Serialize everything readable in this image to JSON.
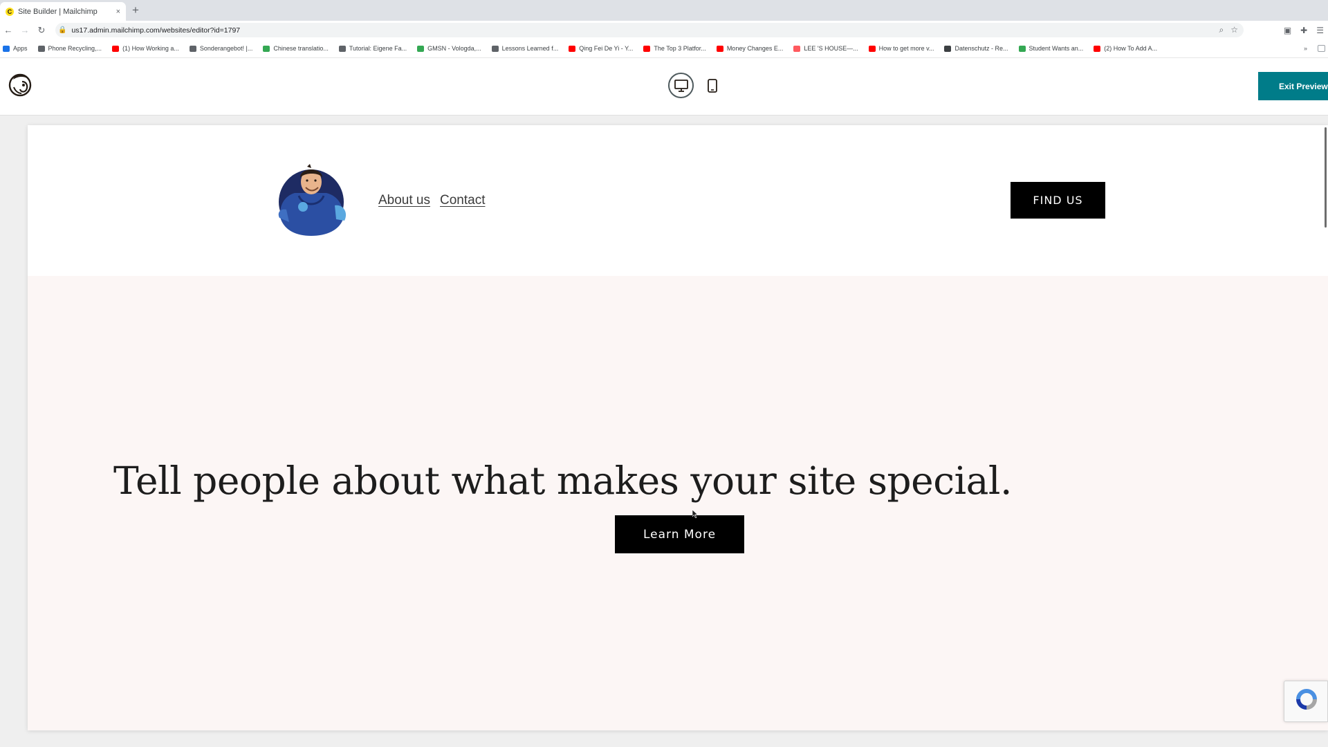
{
  "browser": {
    "tab_title": "Site Builder | Mailchimp",
    "tab_close": "×",
    "new_tab": "+",
    "url": "us17.admin.mailchimp.com/websites/editor?id=1797",
    "bookmarks": [
      {
        "label": "Apps",
        "icon": "apps-grid-icon",
        "color": "#1a73e8"
      },
      {
        "label": "Phone Recycling,...",
        "icon": "search-icon",
        "color": "#5f6368"
      },
      {
        "label": "(1) How Working a...",
        "icon": "youtube-icon",
        "color": "#ff0000"
      },
      {
        "label": "Sonderangebot! |...",
        "icon": "globe-icon",
        "color": "#5f6368"
      },
      {
        "label": "Chinese translatio...",
        "icon": "globe-icon",
        "color": "#34a853"
      },
      {
        "label": "Tutorial: Eigene Fa...",
        "icon": "hash-icon",
        "color": "#5f6368"
      },
      {
        "label": "GMSN - Vologda,...",
        "icon": "globe-icon",
        "color": "#34a853"
      },
      {
        "label": "Lessons Learned f...",
        "icon": "link-icon",
        "color": "#5f6368"
      },
      {
        "label": "Qing Fei De Yi - Y...",
        "icon": "youtube-icon",
        "color": "#ff0000"
      },
      {
        "label": "The Top 3 Platfor...",
        "icon": "youtube-icon",
        "color": "#ff0000"
      },
      {
        "label": "Money Changes E...",
        "icon": "youtube-icon",
        "color": "#ff0000"
      },
      {
        "label": "LEE 'S HOUSE—...",
        "icon": "airbnb-icon",
        "color": "#ff5a5f"
      },
      {
        "label": "How to get more v...",
        "icon": "youtube-icon",
        "color": "#ff0000"
      },
      {
        "label": "Datenschutz - Re...",
        "icon": "bookmark-icon",
        "color": "#3c4043"
      },
      {
        "label": "Student Wants an...",
        "icon": "globe-icon",
        "color": "#34a853"
      },
      {
        "label": "(2) How To Add A...",
        "icon": "youtube-icon",
        "color": "#ff0000"
      }
    ]
  },
  "editor": {
    "exit_preview_label": "Exit Preview",
    "view_modes": [
      "desktop",
      "mobile"
    ],
    "active_view": "desktop",
    "accent_color": "#007c89"
  },
  "site": {
    "nav": [
      "About us",
      "Contact"
    ],
    "find_us_label": "FIND US",
    "hero_heading": "Tell people about what makes your site special.",
    "learn_more_label": "Learn More",
    "hero_background": "#fcf6f5"
  }
}
